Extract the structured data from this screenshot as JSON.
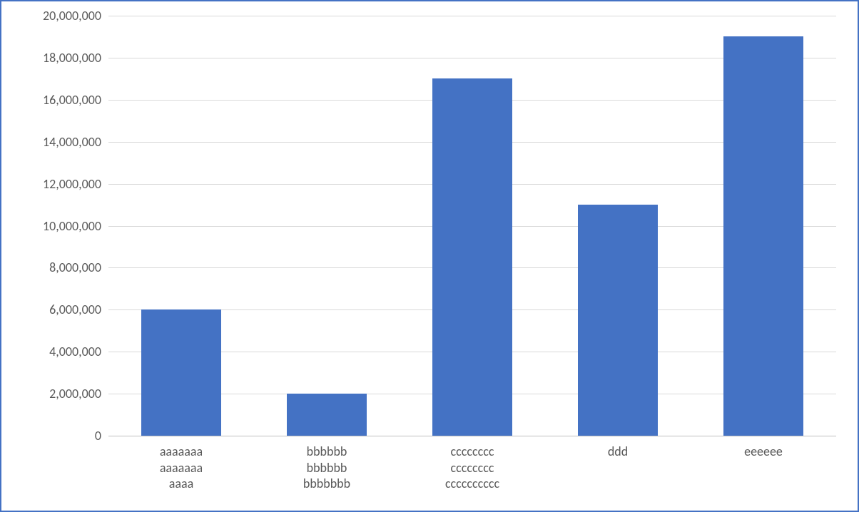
{
  "chart_data": {
    "type": "bar",
    "categories": [
      "aaaaaaa\naaaaaaa\naaaa",
      "bbbbbb\nbbbbbb\nbbbbbbb",
      "cccccccc\ncccccccc\ncccccccccc",
      "ddd",
      "eeeeee"
    ],
    "values": [
      6000000,
      2000000,
      17000000,
      11000000,
      19000000
    ],
    "ylim": [
      0,
      20000000
    ],
    "yticks": [
      0,
      2000000,
      4000000,
      6000000,
      8000000,
      10000000,
      12000000,
      14000000,
      16000000,
      18000000,
      20000000
    ],
    "ytick_labels": [
      "0",
      "2,000,000",
      "4,000,000",
      "6,000,000",
      "8,000,000",
      "10,000,000",
      "12,000,000",
      "14,000,000",
      "16,000,000",
      "18,000,000",
      "20,000,000"
    ],
    "bar_color": "#4472c4",
    "grid_color": "#d9d9d9",
    "axis_color": "#bfbfbf",
    "border_color": "#4472c4"
  }
}
